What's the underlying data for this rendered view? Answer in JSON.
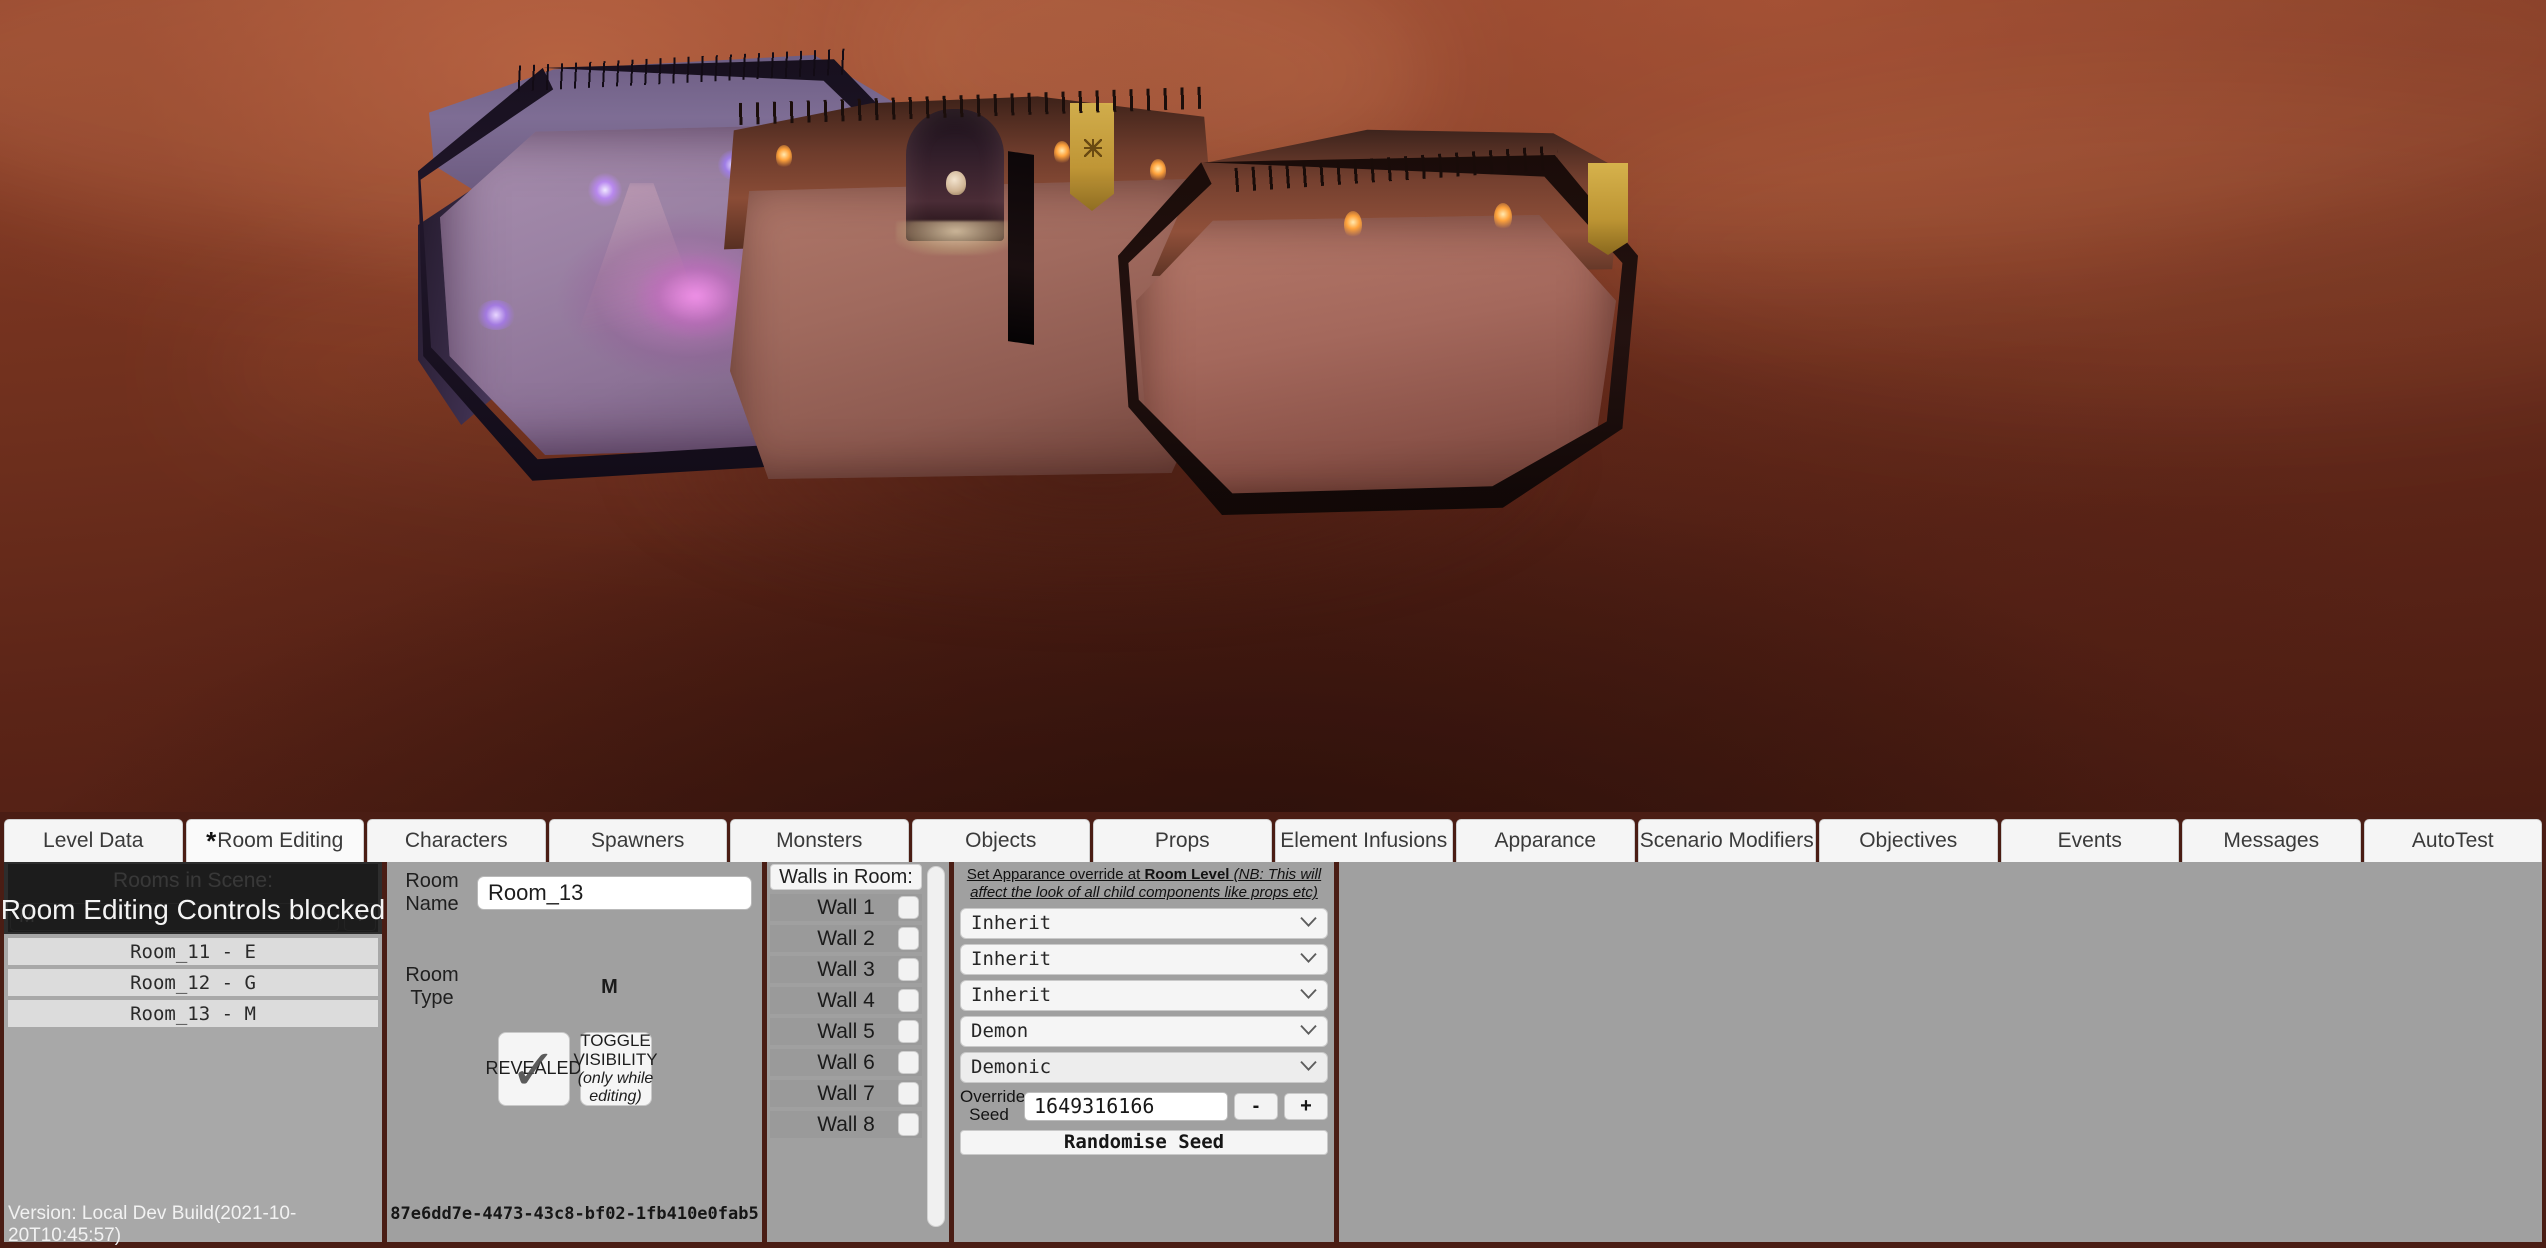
{
  "tabs": [
    {
      "label": "Level Data",
      "active": false,
      "modified": false
    },
    {
      "label": "Room Editing",
      "active": true,
      "modified": true,
      "modified_marker": "*"
    },
    {
      "label": "Characters",
      "active": false,
      "modified": false
    },
    {
      "label": "Spawners",
      "active": false,
      "modified": false
    },
    {
      "label": "Monsters",
      "active": false,
      "modified": false
    },
    {
      "label": "Objects",
      "active": false,
      "modified": false
    },
    {
      "label": "Props",
      "active": false,
      "modified": false
    },
    {
      "label": "Element Infusions",
      "active": false,
      "modified": false
    },
    {
      "label": "Apparance",
      "active": false,
      "modified": false
    },
    {
      "label": "Scenario Modifiers",
      "active": false,
      "modified": false
    },
    {
      "label": "Objectives",
      "active": false,
      "modified": false
    },
    {
      "label": "Events",
      "active": false,
      "modified": false
    },
    {
      "label": "Messages",
      "active": false,
      "modified": false
    },
    {
      "label": "AutoTest",
      "active": false,
      "modified": false
    }
  ],
  "rooms_panel": {
    "header": "Rooms in Scene:",
    "blocked_message": "Room Editing Controls blocked",
    "room_type_select_value": "M",
    "add_button_label": "+",
    "items": [
      {
        "label": "Room_11 - E"
      },
      {
        "label": "Room_12 - G"
      },
      {
        "label": "Room_13 - M"
      }
    ],
    "version": "Version: Local Dev Build(2021-10-20T10:45:57)"
  },
  "room_detail": {
    "name_label": "Room\nName",
    "name_label_line1": "Room",
    "name_label_line2": "Name",
    "name_value": "Room_13",
    "type_label_line1": "Room",
    "type_label_line2": "Type",
    "type_value": "M",
    "revealed_button_label": "REVEALED",
    "revealed_checked": true,
    "toggle_visibility_label_line1": "TOGGLE",
    "toggle_visibility_label_line2": "VISIBILITY",
    "toggle_visibility_label_line3": "(only while",
    "toggle_visibility_label_line4": "editing)",
    "guid": "87e6dd7e-4473-43c8-bf02-1fb410e0fab5"
  },
  "walls_panel": {
    "header": "Walls in Room:",
    "items": [
      {
        "label": "Wall 1"
      },
      {
        "label": "Wall 2"
      },
      {
        "label": "Wall 3"
      },
      {
        "label": "Wall 4"
      },
      {
        "label": "Wall 5"
      },
      {
        "label": "Wall 6"
      },
      {
        "label": "Wall 7"
      },
      {
        "label": "Wall 8"
      }
    ]
  },
  "appearance_panel": {
    "note_part1": "Set Apparance override at ",
    "note_bold": "Room Level",
    "note_italic": " (NB: This will affect the look of all child components like props etc)",
    "dropdowns": [
      {
        "value": "Inherit"
      },
      {
        "value": "Inherit"
      },
      {
        "value": "Inherit"
      },
      {
        "value": "Demon"
      },
      {
        "value": "Demonic"
      }
    ],
    "seed_label_line1": "Override",
    "seed_label_line2": "Seed",
    "seed_value": "1649316166",
    "seed_minus_label": "-",
    "seed_plus_label": "+",
    "randomise_label": "Randomise Seed"
  },
  "colors": {
    "chrome_frame": "#4a1d14",
    "panel_bg": "#a0a0a0",
    "list_item_bg": "#dcdcdc",
    "dark_panel": "#2d2d2d",
    "button_bg": "#f5f5f5"
  }
}
